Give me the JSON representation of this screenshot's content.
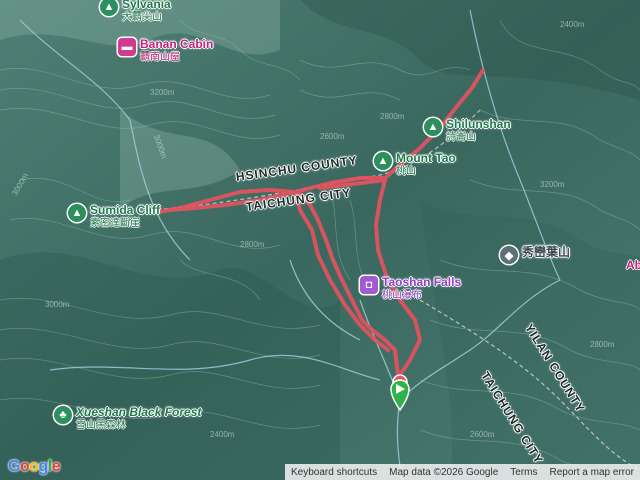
{
  "pois": {
    "sylvania": {
      "name": "Sylvania",
      "sub": "大霸尖山",
      "type": "green"
    },
    "banan_cabin": {
      "name": "Banan Cabin",
      "sub": "霸南山屋",
      "type": "pink"
    },
    "shilunshan": {
      "name": "Shilunshan",
      "sub": "詩崙山",
      "type": "green"
    },
    "mount_tao": {
      "name": "Mount Tao",
      "sub": "桃山",
      "type": "green"
    },
    "sumida_cliff": {
      "name": "Sumida Cliff",
      "sub": "素密達斷崖",
      "type": "green"
    },
    "taoshan_falls": {
      "name": "Taoshan Falls",
      "sub": "桃山瀑布",
      "type": "purple"
    },
    "xiulu_yeshan": {
      "name": "",
      "sub": "秀巒葉山",
      "type": "gray"
    },
    "xueshan_black_forest": {
      "name": "Xueshan Black Forest",
      "sub": "雪山黑森林",
      "type": "green"
    }
  },
  "icons": {
    "sylvania": "mountain-icon",
    "banan_cabin": "bed-icon",
    "shilunshan": "mountain-icon",
    "mount_tao": "mountain-icon",
    "sumida_cliff": "mountain-icon",
    "taoshan_falls": "photo-icon",
    "xiulu_yeshan": "graduation-cap-icon",
    "xueshan_black_forest": "tree-icon",
    "route_start": "start-pin-icon"
  },
  "counties": {
    "hsinchu": "HSINCHU COUNTY",
    "taichung_upper": "TAICHUNG CITY",
    "yilan": "YILAN COUNTY",
    "taichung_lower": "TAICHUNG CITY"
  },
  "edge_label": "Ab",
  "contours": [
    "3000m",
    "3200m",
    "2800m",
    "2600m",
    "2400m",
    "3000m",
    "3200m",
    "2800m",
    "3000m",
    "2400m",
    "2600m",
    "2800m"
  ],
  "footer": {
    "shortcuts": "Keyboard shortcuts",
    "map_data": "Map data ©2026 Google",
    "terms": "Terms",
    "report": "Report a map error"
  },
  "logo": "Google",
  "colors": {
    "route": "#e8515f",
    "start_pin": "#2fb24a",
    "end_pin": "#e8515f",
    "terrain": "#3f6c63",
    "river": "#9fd4e6"
  }
}
